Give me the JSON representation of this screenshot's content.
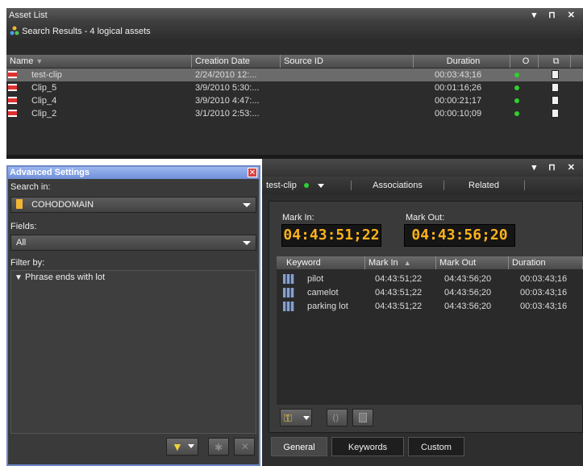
{
  "asset_list": {
    "title": "Asset List",
    "window_controls": "▾ ⊓ ✕",
    "search_results": "Search Results - 4 logical assets",
    "columns": [
      "Name",
      "Creation Date",
      "Source ID",
      "Duration",
      "O",
      ""
    ],
    "rows": [
      {
        "name": "test-clip",
        "date": "2/24/2010 12:...",
        "source": "",
        "duration": "00:03:43;16"
      },
      {
        "name": "Clip_5",
        "date": "3/9/2010 5:30:...",
        "source": "",
        "duration": "00:01:16;26"
      },
      {
        "name": "Clip_4",
        "date": "3/9/2010 4:47:...",
        "source": "",
        "duration": "00:00:21;17"
      },
      {
        "name": "Clip_2",
        "date": "3/1/2010 2:53:...",
        "source": "",
        "duration": "00:00:10;09"
      }
    ]
  },
  "advanced": {
    "title": "Advanced Settings",
    "close": "✕",
    "search_in_label": "Search in:",
    "search_in_value": "COHODOMAIN",
    "fields_label": "Fields:",
    "fields_value": "All",
    "filter_label": "Filter by:",
    "filter_item": "Phrase ends with lot"
  },
  "detail": {
    "window_controls": "▾ ⊓ ✕",
    "clip_name": "test-clip",
    "tab_associations": "Associations",
    "tab_related": "Related",
    "mark_in_label": "Mark In:",
    "mark_out_label": "Mark Out:",
    "mark_in_value": "04:43:51;22",
    "mark_out_value": "04:43:56;20",
    "columns": [
      "Keyword",
      "Mark In",
      "Mark Out",
      "Duration"
    ],
    "rows": [
      {
        "keyword": "pilot",
        "mark_in": "04:43:51;22",
        "mark_out": "04:43:56;20",
        "duration": "00:03:43;16"
      },
      {
        "keyword": "camelot",
        "mark_in": "04:43:51;22",
        "mark_out": "04:43:56;20",
        "duration": "00:03:43;16"
      },
      {
        "keyword": "parking lot",
        "mark_in": "04:43:51;22",
        "mark_out": "04:43:56;20",
        "duration": "00:03:43;16"
      }
    ],
    "bottom_tabs": [
      "General",
      "Keywords",
      "Custom"
    ]
  },
  "colors": {
    "status_green": "#2fd02f",
    "timecode_amber": "#ffb21a",
    "accent_blue": "#6f8fd8"
  }
}
